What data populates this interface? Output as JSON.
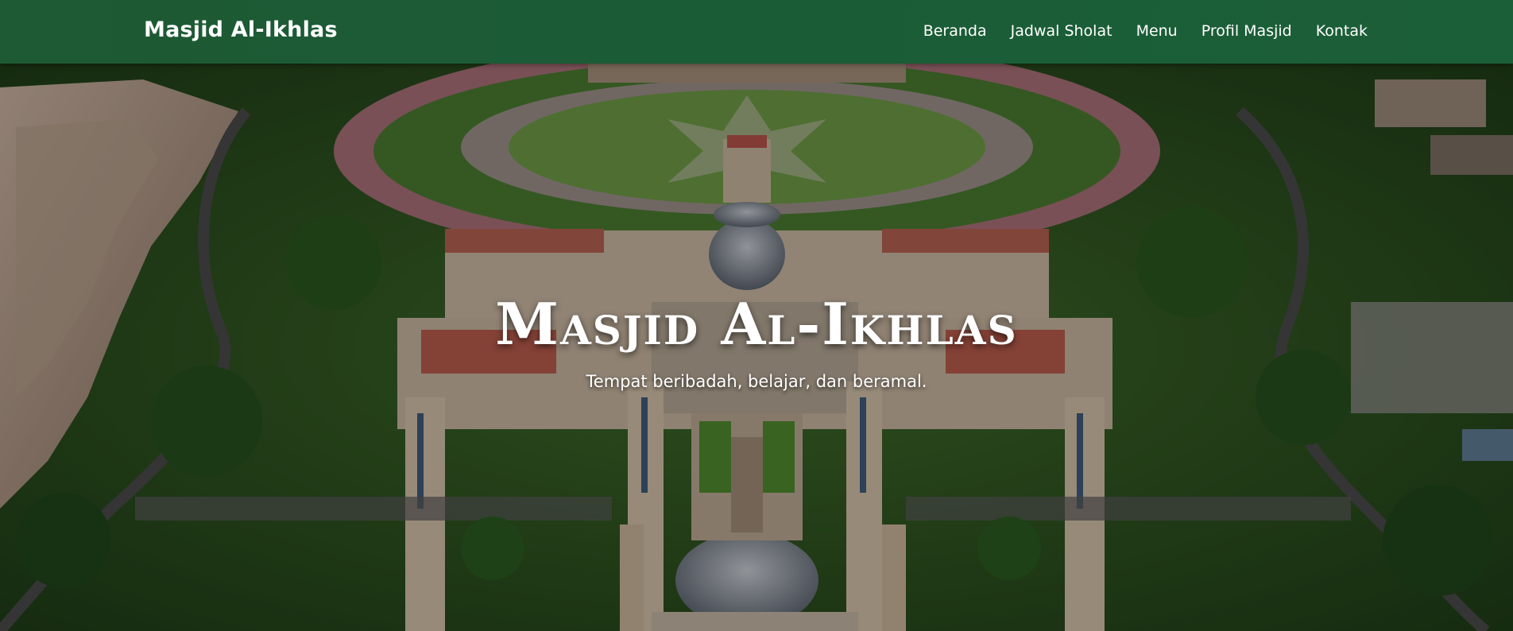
{
  "navbar": {
    "brand": "Masjid Al-Ikhlas",
    "links": [
      "Beranda",
      "Jadwal Sholat",
      "Menu",
      "Profil Masjid",
      "Kontak"
    ]
  },
  "hero": {
    "title": "Masjid Al-Ikhlas",
    "subtitle": "Tempat beribadah, belajar, dan beramal.",
    "background_image": "aerial photo of a large mosque complex with domes, minarets, a star-patterned circular plaza and surrounding trees"
  },
  "colors": {
    "navbar_bg": "#1a5c36",
    "text": "#ffffff"
  }
}
